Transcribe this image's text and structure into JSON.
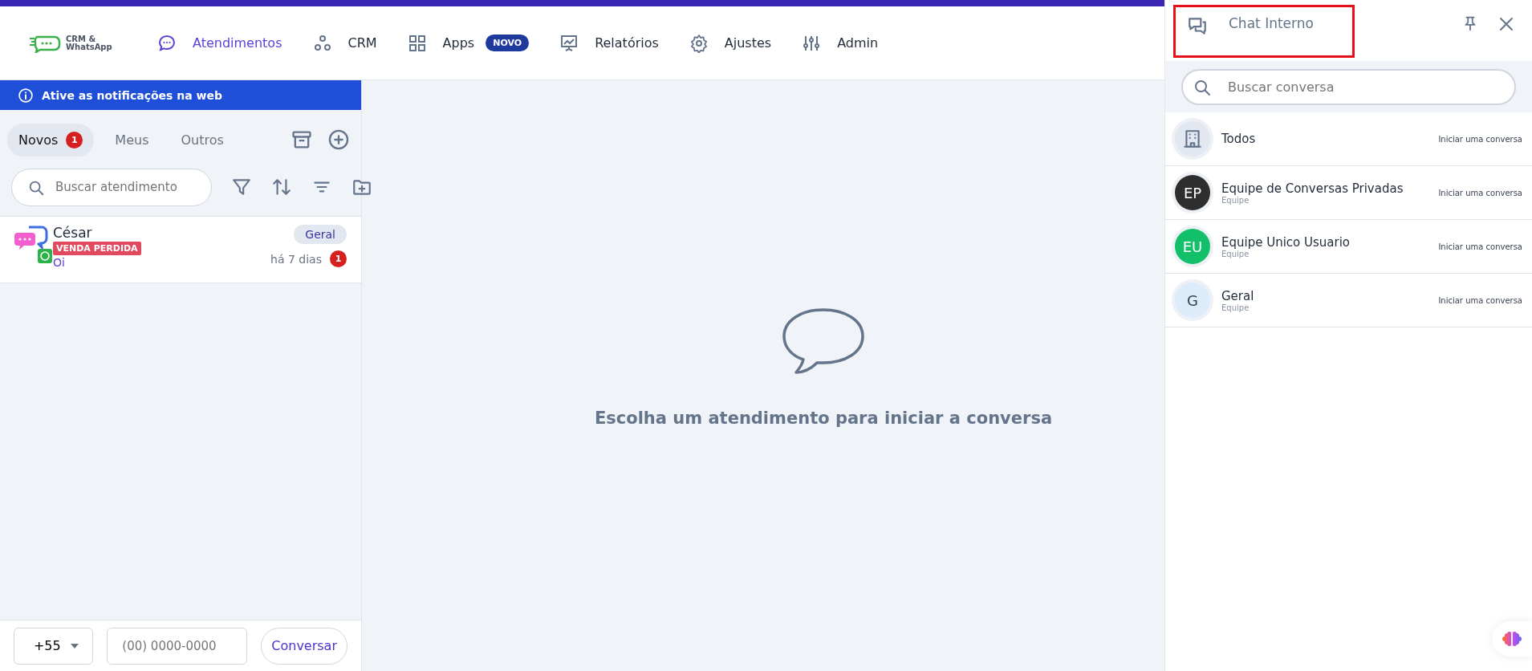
{
  "logo": {
    "text": "CRM & WhatsApp"
  },
  "nav": [
    {
      "label": "Atendimentos",
      "selected": true
    },
    {
      "label": "CRM",
      "selected": false
    },
    {
      "label": "Apps",
      "selected": false,
      "badge": "NOVO"
    },
    {
      "label": "Relatórios",
      "selected": false
    },
    {
      "label": "Ajustes",
      "selected": false
    },
    {
      "label": "Admin",
      "selected": false
    }
  ],
  "notice": "Ative as notificações na web",
  "tabs": [
    {
      "label": "Novos",
      "selected": true,
      "count": "1"
    },
    {
      "label": "Meus",
      "selected": false
    },
    {
      "label": "Outros",
      "selected": false
    }
  ],
  "search": {
    "placeholder": "Buscar atendimento"
  },
  "conversations": [
    {
      "name": "César",
      "tag": "VENDA PERDIDA",
      "message": "Oi",
      "queue": "Geral",
      "time": "há 7 dias",
      "unread": "1"
    }
  ],
  "empty_state": "Escolha um atendimento para iniciar a conversa",
  "dial": {
    "country_code": "+55",
    "placeholder": "(00) 0000-0000",
    "button": "Conversar"
  },
  "chat_panel": {
    "title": "Chat Interno",
    "search_placeholder": "Buscar conversa",
    "items": [
      {
        "kind": "building",
        "name": "Todos",
        "action": "Iniciar uma conversa"
      },
      {
        "kind": "initials",
        "initials": "EP",
        "color": "#2e2e2e",
        "name": "Equipe de Conversas Privadas",
        "subtitle": "Equipe",
        "action": "Iniciar uma conversa"
      },
      {
        "kind": "initials",
        "initials": "EU",
        "color": "#12c06a",
        "name": "Equipe Unico Usuario",
        "subtitle": "Equipe",
        "action": "Iniciar uma conversa"
      },
      {
        "kind": "initials",
        "initials": "G",
        "color": "#dcecfb",
        "name": "Geral",
        "subtitle": "Equipe",
        "action": "Iniciar uma conversa"
      }
    ]
  }
}
